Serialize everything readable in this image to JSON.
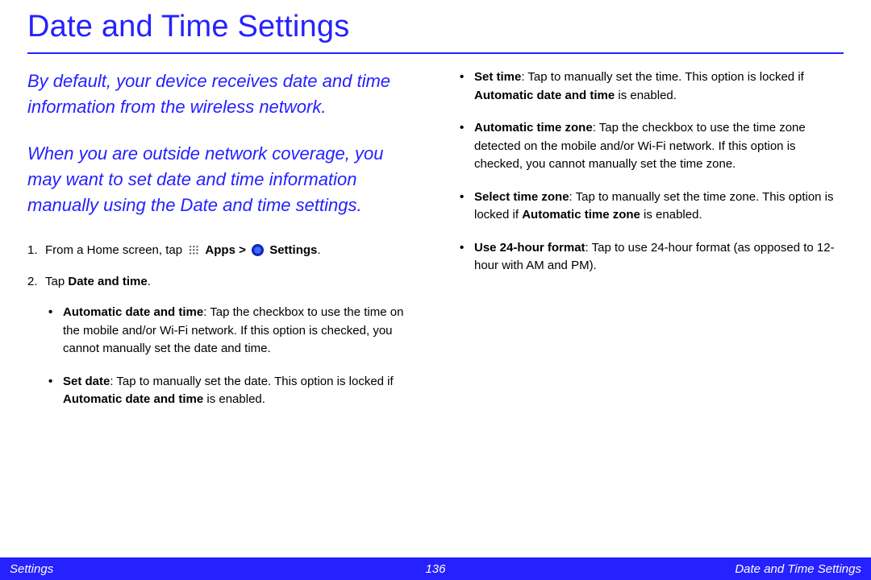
{
  "accent": "#2521ff",
  "title": "Date and Time Settings",
  "intro": [
    "By default, your device receives date and time information from the wireless network.",
    "When you are outside network coverage, you may want to set date and time information manually using the Date and time settings."
  ],
  "step1": {
    "prefix": "From a Home screen, tap ",
    "apps_label": "Apps",
    "gt": " > ",
    "settings_label": "Settings",
    "suffix": "."
  },
  "step2": {
    "prefix": "Tap ",
    "bold": "Date and time",
    "suffix": "."
  },
  "bullets_left": [
    {
      "label": "Automatic date and time",
      "text": ": Tap the checkbox to use the time on the mobile and/or Wi-Fi network. If this option is checked, you cannot manually set the date and time."
    },
    {
      "label": "Set date",
      "text_pre": ": Tap to manually set the date. This option is locked if ",
      "bold_mid": "Automatic date and time",
      "text_post": " is enabled."
    }
  ],
  "bullets_right": [
    {
      "label": "Set time",
      "text_pre": ": Tap to manually set the time. This option is locked if ",
      "bold_mid": "Automatic date and time",
      "text_post": " is enabled."
    },
    {
      "label": "Automatic time zone",
      "text": ": Tap the checkbox to use the time zone detected on the mobile and/or Wi-Fi network. If this option is checked, you cannot manually set the time zone."
    },
    {
      "label": "Select time zone",
      "text_pre": ": Tap to manually set the time zone. This option is locked if ",
      "bold_mid": "Automatic time zone",
      "text_post": " is enabled."
    },
    {
      "label": "Use 24-hour format",
      "text": ": Tap to use 24-hour format (as opposed to 12-hour with AM and PM)."
    }
  ],
  "footer": {
    "left": "Settings",
    "center": "136",
    "right": "Date and Time Settings"
  }
}
